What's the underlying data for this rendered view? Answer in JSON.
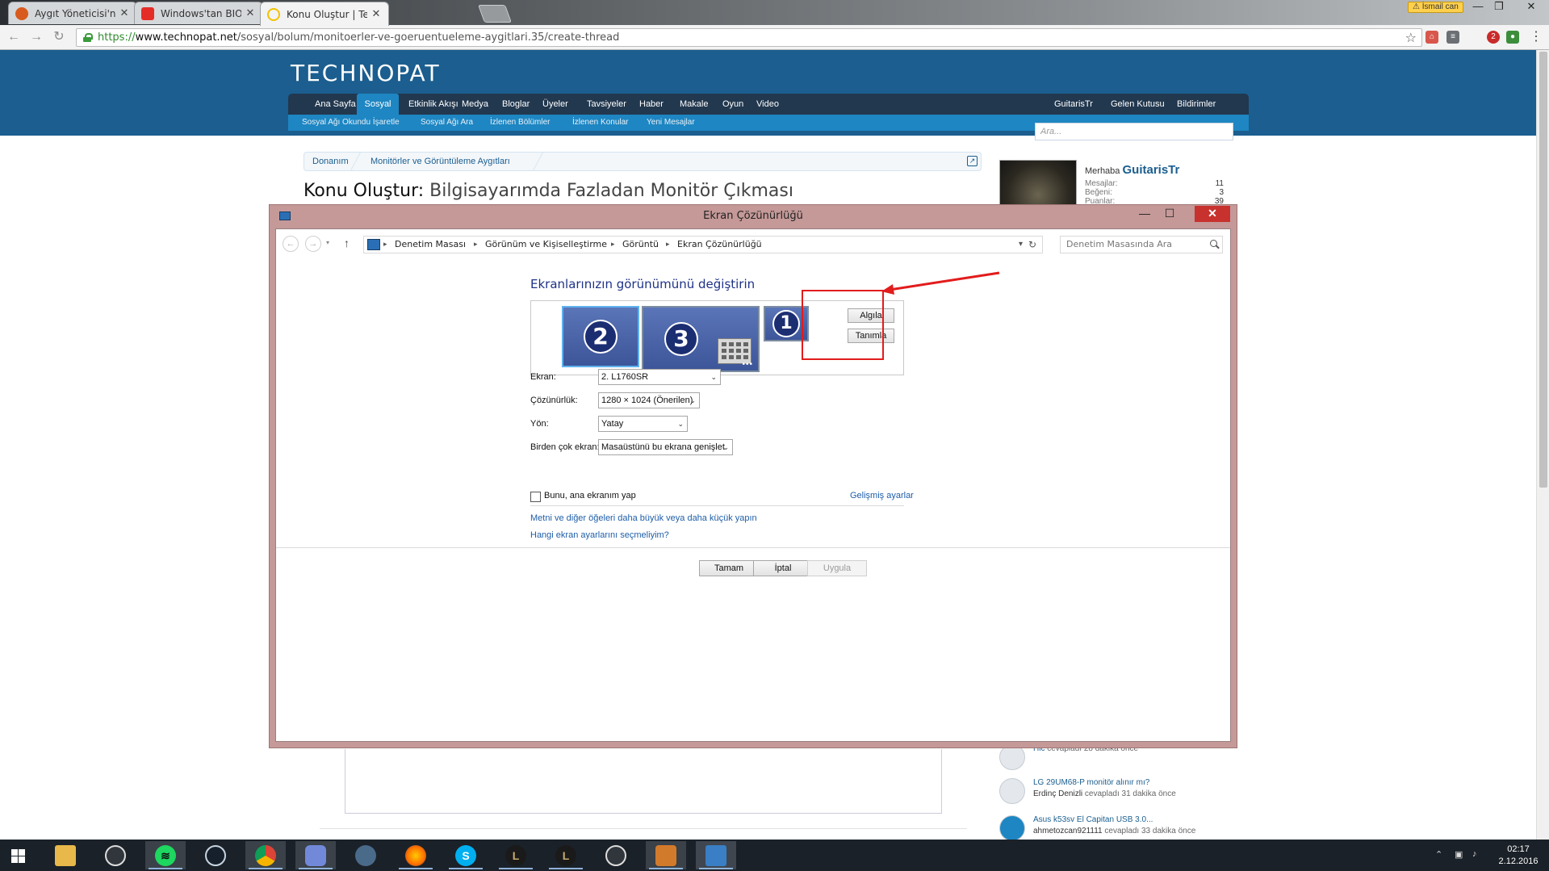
{
  "browser": {
    "tabs": [
      {
        "label": "Aygıt Yöneticisi'nde Takı",
        "close": "✕",
        "icon_color": "#d85a1e"
      },
      {
        "label": "Windows'tan BIOS'a Giriş",
        "close": "✕",
        "icon_color": "#e52d27"
      },
      {
        "label": "Konu Oluştur | Technopa",
        "close": "✕",
        "icon_color": "#f2c200"
      }
    ],
    "profile_name": "İsmail can",
    "url_scheme": "https://",
    "url_host": "www.technopat.net",
    "url_path": "/sosyal/bolum/monitoerler-ve-goeruentueleme-aygitlari.35/create-thread",
    "bookmark_icon": "☆",
    "extension_badge": "2",
    "window_controls": [
      "—",
      "❐",
      "✕"
    ]
  },
  "site": {
    "logo": "TECHNOPAT",
    "nav": [
      "Ana Sayfa",
      "Sosyal",
      "Etkinlik Akışı",
      "Medya",
      "Bloglar",
      "Üyeler",
      "Tavsiyeler",
      "Haber",
      "Makale",
      "Oyun",
      "Video"
    ],
    "nav_active": "Sosyal",
    "nav_right": [
      "GuitarisTr",
      "Gelen Kutusu",
      "Bildirimler"
    ],
    "subnav": [
      "Sosyal Ağı Okundu İşaretle",
      "Sosyal Ağı Ara",
      "İzlenen Bölümler",
      "İzlenen Konular",
      "Yeni Mesajlar"
    ],
    "search_placeholder": "Ara...",
    "breadcrumb": [
      "Donanım",
      "Monitörler ve Görüntüleme Aygıtları"
    ],
    "title_prefix": "Konu Oluştur:",
    "title_thread": "Bilgisayarımda Fazladan Monitör Çıkması",
    "visitor": {
      "greeting": "Merhaba",
      "name": "GuitarisTr",
      "stats": [
        {
          "label": "Mesajlar:",
          "value": "11"
        },
        {
          "label": "Beğeni:",
          "value": "3"
        },
        {
          "label": "Puanlar:",
          "value": "39"
        }
      ]
    },
    "activity": [
      {
        "title": "",
        "user": "Hic",
        "meta": "cevapladı 28 dakika önce"
      },
      {
        "title": "LG 29UM68-P monitör alınır mı?",
        "user": "Erdinç Denizli",
        "meta": "cevapladı 31 dakika önce"
      },
      {
        "title": "Asus k53sv El Capitan USB 3.0...",
        "user": "ahmetozcan921111",
        "meta": "cevapladı 33 dakika önce"
      }
    ]
  },
  "dialog": {
    "title": "Ekran Çözünürlüğü",
    "controls": [
      "—",
      "☐",
      "✕"
    ],
    "address": [
      "Denetim Masası",
      "Görünüm ve Kişiselleştirme",
      "Görüntü",
      "Ekran Çözünürlüğü"
    ],
    "search_placeholder": "Denetim Masasında Ara",
    "heading": "Ekranlarınızın görünümünü değiştirin",
    "monitors": [
      "2",
      "3",
      "1"
    ],
    "detect_button": "Algıla",
    "identify_button": "Tanımla",
    "fields": [
      {
        "label": "Ekran:",
        "value": "2. L1760SR"
      },
      {
        "label": "Çözünürlük:",
        "value": "1280 × 1024 (Önerilen)"
      },
      {
        "label": "Yön:",
        "value": "Yatay"
      },
      {
        "label": "Birden çok ekran:",
        "value": "Masaüstünü bu ekrana genişlet"
      }
    ],
    "primary_checkbox": "Bunu, ana ekranım yap",
    "advanced_link": "Gelişmiş ayarlar",
    "links": [
      "Metni ve diğer öğeleri daha büyük veya daha küçük yapın",
      "Hangi ekran ayarlarını seçmeliyim?"
    ],
    "buttons": {
      "ok": "Tamam",
      "cancel": "İptal",
      "apply": "Uygula"
    },
    "annotation_color": "#e21c1c"
  },
  "taskbar": {
    "apps": [
      "file-explorer",
      "obs",
      "spotify",
      "steam",
      "chrome",
      "discord",
      "app-7",
      "firefox",
      "skype",
      "league-of-legends",
      "league-of-legends-2",
      "obs-2",
      "app-13",
      "control-panel"
    ],
    "clock_time": "02:17",
    "clock_date": "2.12.2016"
  }
}
